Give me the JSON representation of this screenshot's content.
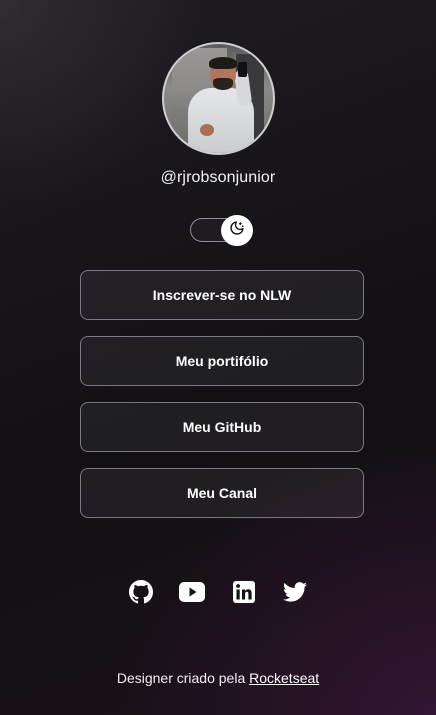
{
  "profile": {
    "username": "@rjrobsonjunior",
    "avatar_alt": "Foto de perfil"
  },
  "theme_switch": {
    "icon": "moon-icon"
  },
  "links": [
    {
      "label": "Inscrever-se no NLW"
    },
    {
      "label": "Meu portifólio"
    },
    {
      "label": "Meu GitHub"
    },
    {
      "label": "Meu Canal"
    }
  ],
  "social": [
    {
      "icon": "github-icon"
    },
    {
      "icon": "youtube-icon"
    },
    {
      "icon": "linkedin-icon"
    },
    {
      "icon": "twitter-icon"
    }
  ],
  "footer": {
    "text": "Designer criado pela ",
    "link_label": "Rocketseat"
  },
  "colors": {
    "background": "#121014",
    "button_border": "#7c7a80",
    "text": "#ffffff"
  }
}
